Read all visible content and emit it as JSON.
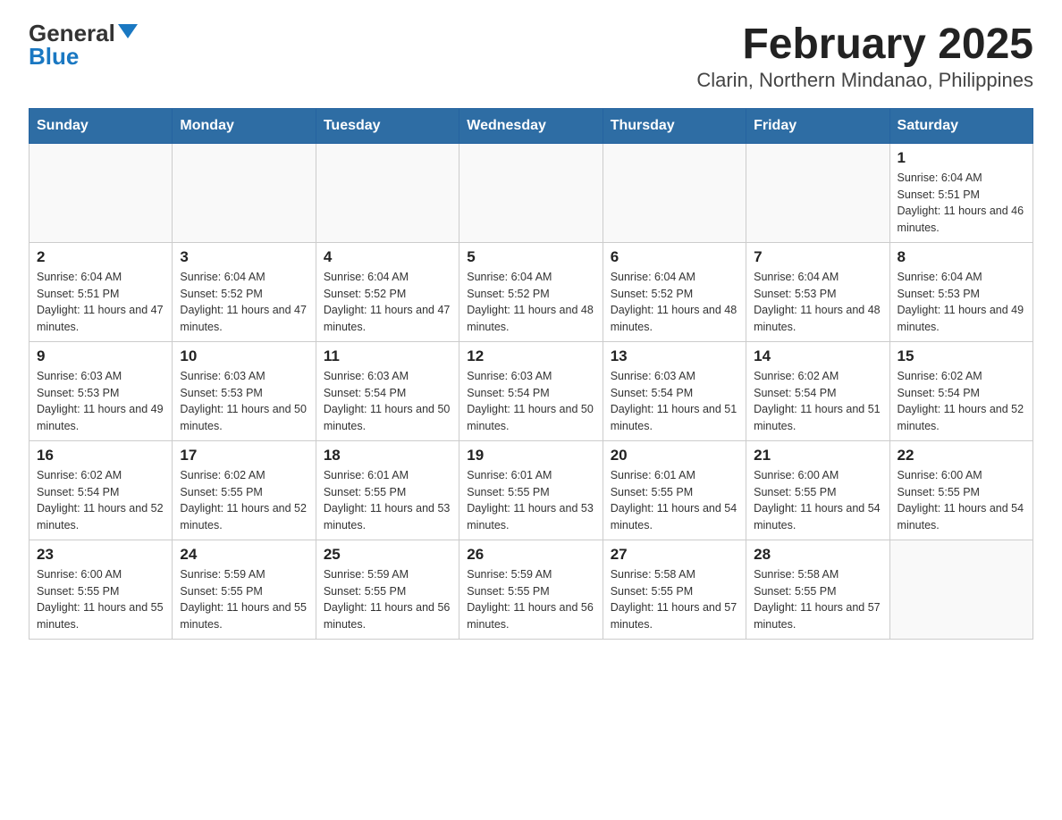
{
  "logo": {
    "general": "General",
    "blue": "Blue",
    "triangle": "▲"
  },
  "title": "February 2025",
  "subtitle": "Clarin, Northern Mindanao, Philippines",
  "days_of_week": [
    "Sunday",
    "Monday",
    "Tuesday",
    "Wednesday",
    "Thursday",
    "Friday",
    "Saturday"
  ],
  "weeks": [
    [
      {
        "day": "",
        "info": ""
      },
      {
        "day": "",
        "info": ""
      },
      {
        "day": "",
        "info": ""
      },
      {
        "day": "",
        "info": ""
      },
      {
        "day": "",
        "info": ""
      },
      {
        "day": "",
        "info": ""
      },
      {
        "day": "1",
        "info": "Sunrise: 6:04 AM\nSunset: 5:51 PM\nDaylight: 11 hours and 46 minutes."
      }
    ],
    [
      {
        "day": "2",
        "info": "Sunrise: 6:04 AM\nSunset: 5:51 PM\nDaylight: 11 hours and 47 minutes."
      },
      {
        "day": "3",
        "info": "Sunrise: 6:04 AM\nSunset: 5:52 PM\nDaylight: 11 hours and 47 minutes."
      },
      {
        "day": "4",
        "info": "Sunrise: 6:04 AM\nSunset: 5:52 PM\nDaylight: 11 hours and 47 minutes."
      },
      {
        "day": "5",
        "info": "Sunrise: 6:04 AM\nSunset: 5:52 PM\nDaylight: 11 hours and 48 minutes."
      },
      {
        "day": "6",
        "info": "Sunrise: 6:04 AM\nSunset: 5:52 PM\nDaylight: 11 hours and 48 minutes."
      },
      {
        "day": "7",
        "info": "Sunrise: 6:04 AM\nSunset: 5:53 PM\nDaylight: 11 hours and 48 minutes."
      },
      {
        "day": "8",
        "info": "Sunrise: 6:04 AM\nSunset: 5:53 PM\nDaylight: 11 hours and 49 minutes."
      }
    ],
    [
      {
        "day": "9",
        "info": "Sunrise: 6:03 AM\nSunset: 5:53 PM\nDaylight: 11 hours and 49 minutes."
      },
      {
        "day": "10",
        "info": "Sunrise: 6:03 AM\nSunset: 5:53 PM\nDaylight: 11 hours and 50 minutes."
      },
      {
        "day": "11",
        "info": "Sunrise: 6:03 AM\nSunset: 5:54 PM\nDaylight: 11 hours and 50 minutes."
      },
      {
        "day": "12",
        "info": "Sunrise: 6:03 AM\nSunset: 5:54 PM\nDaylight: 11 hours and 50 minutes."
      },
      {
        "day": "13",
        "info": "Sunrise: 6:03 AM\nSunset: 5:54 PM\nDaylight: 11 hours and 51 minutes."
      },
      {
        "day": "14",
        "info": "Sunrise: 6:02 AM\nSunset: 5:54 PM\nDaylight: 11 hours and 51 minutes."
      },
      {
        "day": "15",
        "info": "Sunrise: 6:02 AM\nSunset: 5:54 PM\nDaylight: 11 hours and 52 minutes."
      }
    ],
    [
      {
        "day": "16",
        "info": "Sunrise: 6:02 AM\nSunset: 5:54 PM\nDaylight: 11 hours and 52 minutes."
      },
      {
        "day": "17",
        "info": "Sunrise: 6:02 AM\nSunset: 5:55 PM\nDaylight: 11 hours and 52 minutes."
      },
      {
        "day": "18",
        "info": "Sunrise: 6:01 AM\nSunset: 5:55 PM\nDaylight: 11 hours and 53 minutes."
      },
      {
        "day": "19",
        "info": "Sunrise: 6:01 AM\nSunset: 5:55 PM\nDaylight: 11 hours and 53 minutes."
      },
      {
        "day": "20",
        "info": "Sunrise: 6:01 AM\nSunset: 5:55 PM\nDaylight: 11 hours and 54 minutes."
      },
      {
        "day": "21",
        "info": "Sunrise: 6:00 AM\nSunset: 5:55 PM\nDaylight: 11 hours and 54 minutes."
      },
      {
        "day": "22",
        "info": "Sunrise: 6:00 AM\nSunset: 5:55 PM\nDaylight: 11 hours and 54 minutes."
      }
    ],
    [
      {
        "day": "23",
        "info": "Sunrise: 6:00 AM\nSunset: 5:55 PM\nDaylight: 11 hours and 55 minutes."
      },
      {
        "day": "24",
        "info": "Sunrise: 5:59 AM\nSunset: 5:55 PM\nDaylight: 11 hours and 55 minutes."
      },
      {
        "day": "25",
        "info": "Sunrise: 5:59 AM\nSunset: 5:55 PM\nDaylight: 11 hours and 56 minutes."
      },
      {
        "day": "26",
        "info": "Sunrise: 5:59 AM\nSunset: 5:55 PM\nDaylight: 11 hours and 56 minutes."
      },
      {
        "day": "27",
        "info": "Sunrise: 5:58 AM\nSunset: 5:55 PM\nDaylight: 11 hours and 57 minutes."
      },
      {
        "day": "28",
        "info": "Sunrise: 5:58 AM\nSunset: 5:55 PM\nDaylight: 11 hours and 57 minutes."
      },
      {
        "day": "",
        "info": ""
      }
    ]
  ]
}
